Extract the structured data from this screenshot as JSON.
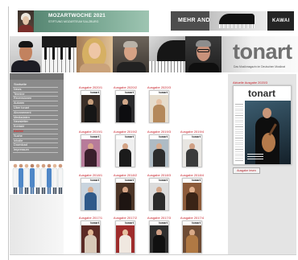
{
  "banners": {
    "mozartwoche": {
      "headline": "MOZARTWOCHE 2021",
      "subline": "STIFTUNG MOZARTEUM SALZBURG"
    },
    "kawai": {
      "headline": "MEHR ANDE",
      "brand": "KAWAI"
    }
  },
  "logo": {
    "name": "tonart",
    "tagline": "Das Musikmagazin im Deutschen Musikrat"
  },
  "sidebar": {
    "items": [
      {
        "label": "Startseite"
      },
      {
        "label": "News"
      },
      {
        "label": "Termine"
      },
      {
        "label": "Rezensionen"
      },
      {
        "label": "Autoren"
      },
      {
        "label": "Über tonart"
      },
      {
        "label": "Abonnement"
      },
      {
        "label": "Mediadaten"
      },
      {
        "label": "Newsletter"
      },
      {
        "label": "Kontakt"
      },
      {
        "label": "Archiv",
        "active": true
      },
      {
        "label": "Suche"
      },
      {
        "label": "Inhalte"
      },
      {
        "label": "Download"
      },
      {
        "label": "Impressum"
      }
    ]
  },
  "archive": {
    "cover_logo": "tonart",
    "rows": [
      [
        {
          "label": "Ausgabe 2020/1"
        },
        {
          "label": "Ausgabe 2020/2"
        },
        {
          "label": "Ausgabe 2020/3"
        }
      ],
      [
        {
          "label": "Ausgabe 2019/1"
        },
        {
          "label": "Ausgabe 2019/2"
        },
        {
          "label": "Ausgabe 2019/3"
        },
        {
          "label": "Ausgabe 2019/4"
        }
      ],
      [
        {
          "label": "Ausgabe 2018/1"
        },
        {
          "label": "Ausgabe 2018/2"
        },
        {
          "label": "Ausgabe 2018/3"
        },
        {
          "label": "Ausgabe 2018/4"
        }
      ],
      [
        {
          "label": "Ausgabe 2017/1"
        },
        {
          "label": "Ausgabe 2017/2"
        },
        {
          "label": "Ausgabe 2017/3"
        },
        {
          "label": "Ausgabe 2017/4"
        }
      ]
    ]
  },
  "current_issue": {
    "heading": "Aktuelle Ausgabe 2020/3",
    "cover_logo": "tonart",
    "button_label": "Ausgabe lesen"
  },
  "colors": {
    "accent_red": "#c8232c",
    "sidebar_grey": "#8b8b8b",
    "panel_grey": "#e4e4e4",
    "logo_grey": "#707070"
  }
}
